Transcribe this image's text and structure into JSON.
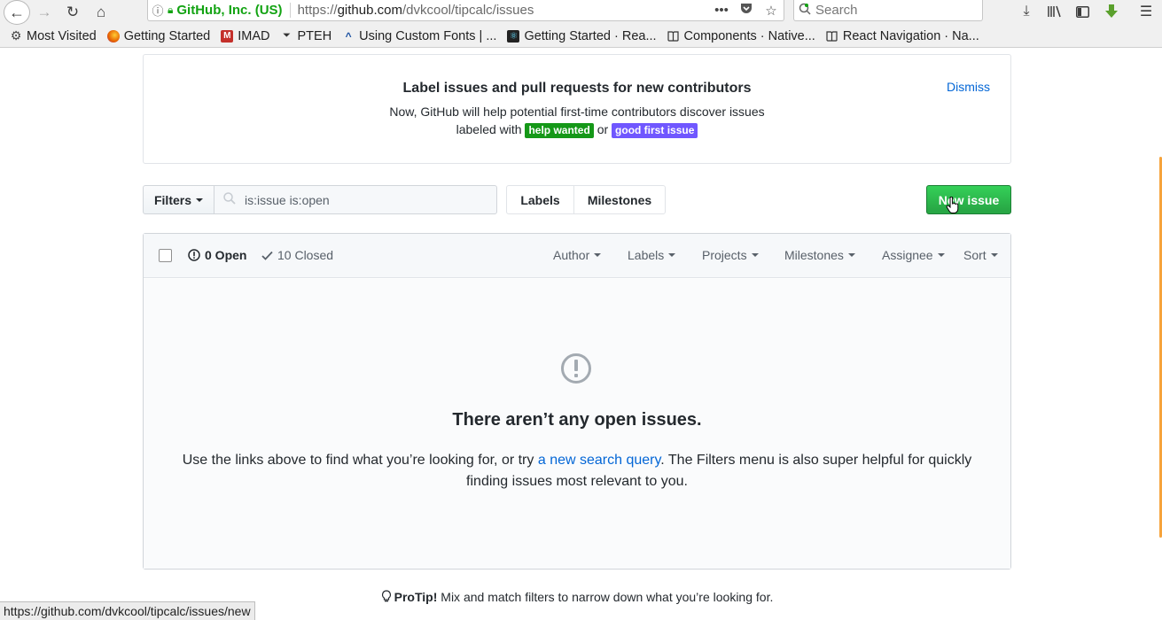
{
  "browser": {
    "url_org": "GitHub, Inc. (US)",
    "url_prefix": "https://",
    "url_domain": "github.com",
    "url_path": "/dvkcool/tipcalc/issues",
    "search_placeholder": "Search",
    "status_url": "https://github.com/dvkcool/tipcalc/issues/new"
  },
  "bookmarks": [
    {
      "label": "Most Visited",
      "icon": "gear-icon"
    },
    {
      "label": "Getting Started",
      "icon": "firefox-icon"
    },
    {
      "label": "IMAD",
      "icon": "imad-icon"
    },
    {
      "label": "PTEH",
      "icon": "pteh-icon"
    },
    {
      "label": "Using Custom Fonts | ...",
      "icon": "caret-icon"
    },
    {
      "label": "Getting Started · Rea...",
      "icon": "react-icon"
    },
    {
      "label": "Components · Native...",
      "icon": "book-icon"
    },
    {
      "label": "React Navigation · Na...",
      "icon": "book-icon"
    }
  ],
  "onboarding": {
    "title": "Label issues and pull requests for new contributors",
    "line1": "Now, GitHub will help potential first-time contributors discover issues",
    "line2_prefix": "labeled with",
    "label1": "help wanted",
    "label1_color": "#159818",
    "or": "or",
    "label2": "good first issue",
    "label2_color": "#7057ff",
    "dismiss": "Dismiss"
  },
  "filters": {
    "filters_label": "Filters",
    "search_value": "is:issue is:open",
    "labels_tab": "Labels",
    "milestones_tab": "Milestones",
    "new_issue": "New issue"
  },
  "issues": {
    "open_count": "0 Open",
    "closed_count": "10 Closed",
    "selects": [
      "Author",
      "Labels",
      "Projects",
      "Milestones",
      "Assignee",
      "Sort"
    ],
    "blank_title": "There aren’t any open issues.",
    "blank_text_before": "Use the links above to find what you’re looking for, or try",
    "blank_link": "a new search query",
    "blank_text_after": ". The Filters menu is also super helpful for quickly finding issues most relevant to you."
  },
  "protip": {
    "label": "ProTip!",
    "text": "Mix and match filters to narrow down what you’re looking for."
  }
}
